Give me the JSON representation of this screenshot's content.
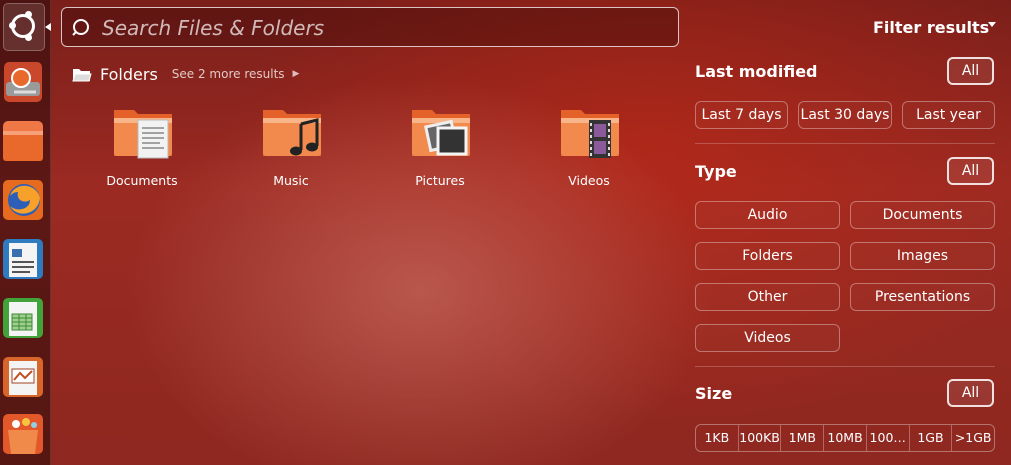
{
  "search": {
    "placeholder": "Search Files & Folders",
    "value": ""
  },
  "folders": {
    "title": "Folders",
    "see_more": "See 2 more results",
    "items": [
      {
        "label": "Documents",
        "icon": "folder-documents-icon"
      },
      {
        "label": "Music",
        "icon": "folder-music-icon"
      },
      {
        "label": "Pictures",
        "icon": "folder-pictures-icon"
      },
      {
        "label": "Videos",
        "icon": "folder-videos-icon"
      }
    ]
  },
  "filter": {
    "title": "Filter results",
    "last_modified": {
      "title": "Last modified",
      "all": "All",
      "options": [
        "Last 7 days",
        "Last 30 days",
        "Last year"
      ]
    },
    "type": {
      "title": "Type",
      "all": "All",
      "options": [
        "Audio",
        "Documents",
        "Folders",
        "Images",
        "Other",
        "Presentations",
        "Videos"
      ]
    },
    "size": {
      "title": "Size",
      "all": "All",
      "options": [
        "1KB",
        "100KB",
        "1MB",
        "10MB",
        "100…",
        "1GB",
        ">1GB"
      ]
    }
  },
  "launcher": {
    "items": [
      "dash-home-icon",
      "installer-icon",
      "home-folder-icon",
      "firefox-icon",
      "writer-icon",
      "calc-icon",
      "impress-icon",
      "software-center-icon"
    ]
  },
  "colors": {
    "accent": "#f07746",
    "background": "#8e2820"
  }
}
